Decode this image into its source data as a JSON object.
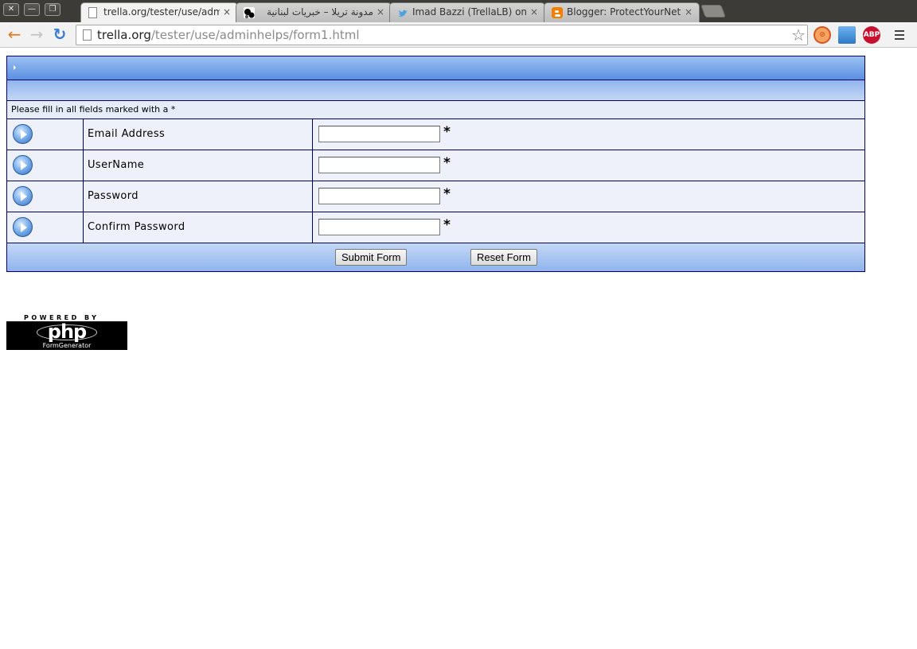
{
  "window": {
    "close_label": "✕",
    "minimize_label": "—",
    "restore_label": "❐"
  },
  "tabs": [
    {
      "title": "trella.org/tester/use/adm",
      "close": "×",
      "active": true,
      "favicon": "page-icon"
    },
    {
      "title": "مدونة تريلا – خبريات لبنانية",
      "close": "×",
      "active": false,
      "favicon": "trella-icon"
    },
    {
      "title": "Imad Bazzi (TrellaLB) on T",
      "close": "×",
      "active": false,
      "favicon": "twitter-icon"
    },
    {
      "title": "Blogger: ProtectYourNet",
      "close": "×",
      "active": false,
      "favicon": "blogger-icon"
    }
  ],
  "toolbar": {
    "back_icon": "←",
    "forward_icon": "→",
    "reload_icon": "↻",
    "url_host": "trella.org",
    "url_path": "/tester/use/adminhelps/form1.html",
    "bookmark_star": "☆",
    "extensions": [
      {
        "name": "blocked-extension-icon",
        "label": "⊘",
        "color": "#d9541e"
      },
      {
        "name": "screen-capture-icon",
        "label": "",
        "color": "#2b78c6"
      },
      {
        "name": "adblock-plus-icon",
        "label": "ABP",
        "color": "#c8102e"
      }
    ]
  },
  "form": {
    "instruction": "Please fill in all fields marked with a *",
    "fields": [
      {
        "label": "Email Address",
        "value": "",
        "required": "*"
      },
      {
        "label": "UserName",
        "value": "",
        "required": "*"
      },
      {
        "label": "Password",
        "value": "",
        "required": "*"
      },
      {
        "label": "Confirm Password",
        "value": "",
        "required": "*"
      }
    ],
    "submit_label": "Submit Form",
    "reset_label": "Reset Form"
  },
  "logo": {
    "powered_by": "POWERED BY",
    "brand": "php",
    "product": "FormGenerator"
  },
  "colors": {
    "border": "#000066",
    "header_gradient_top": "#9cc1f2",
    "header_gradient_bottom": "#5b8fe0",
    "row_background": "#eef1f9"
  }
}
